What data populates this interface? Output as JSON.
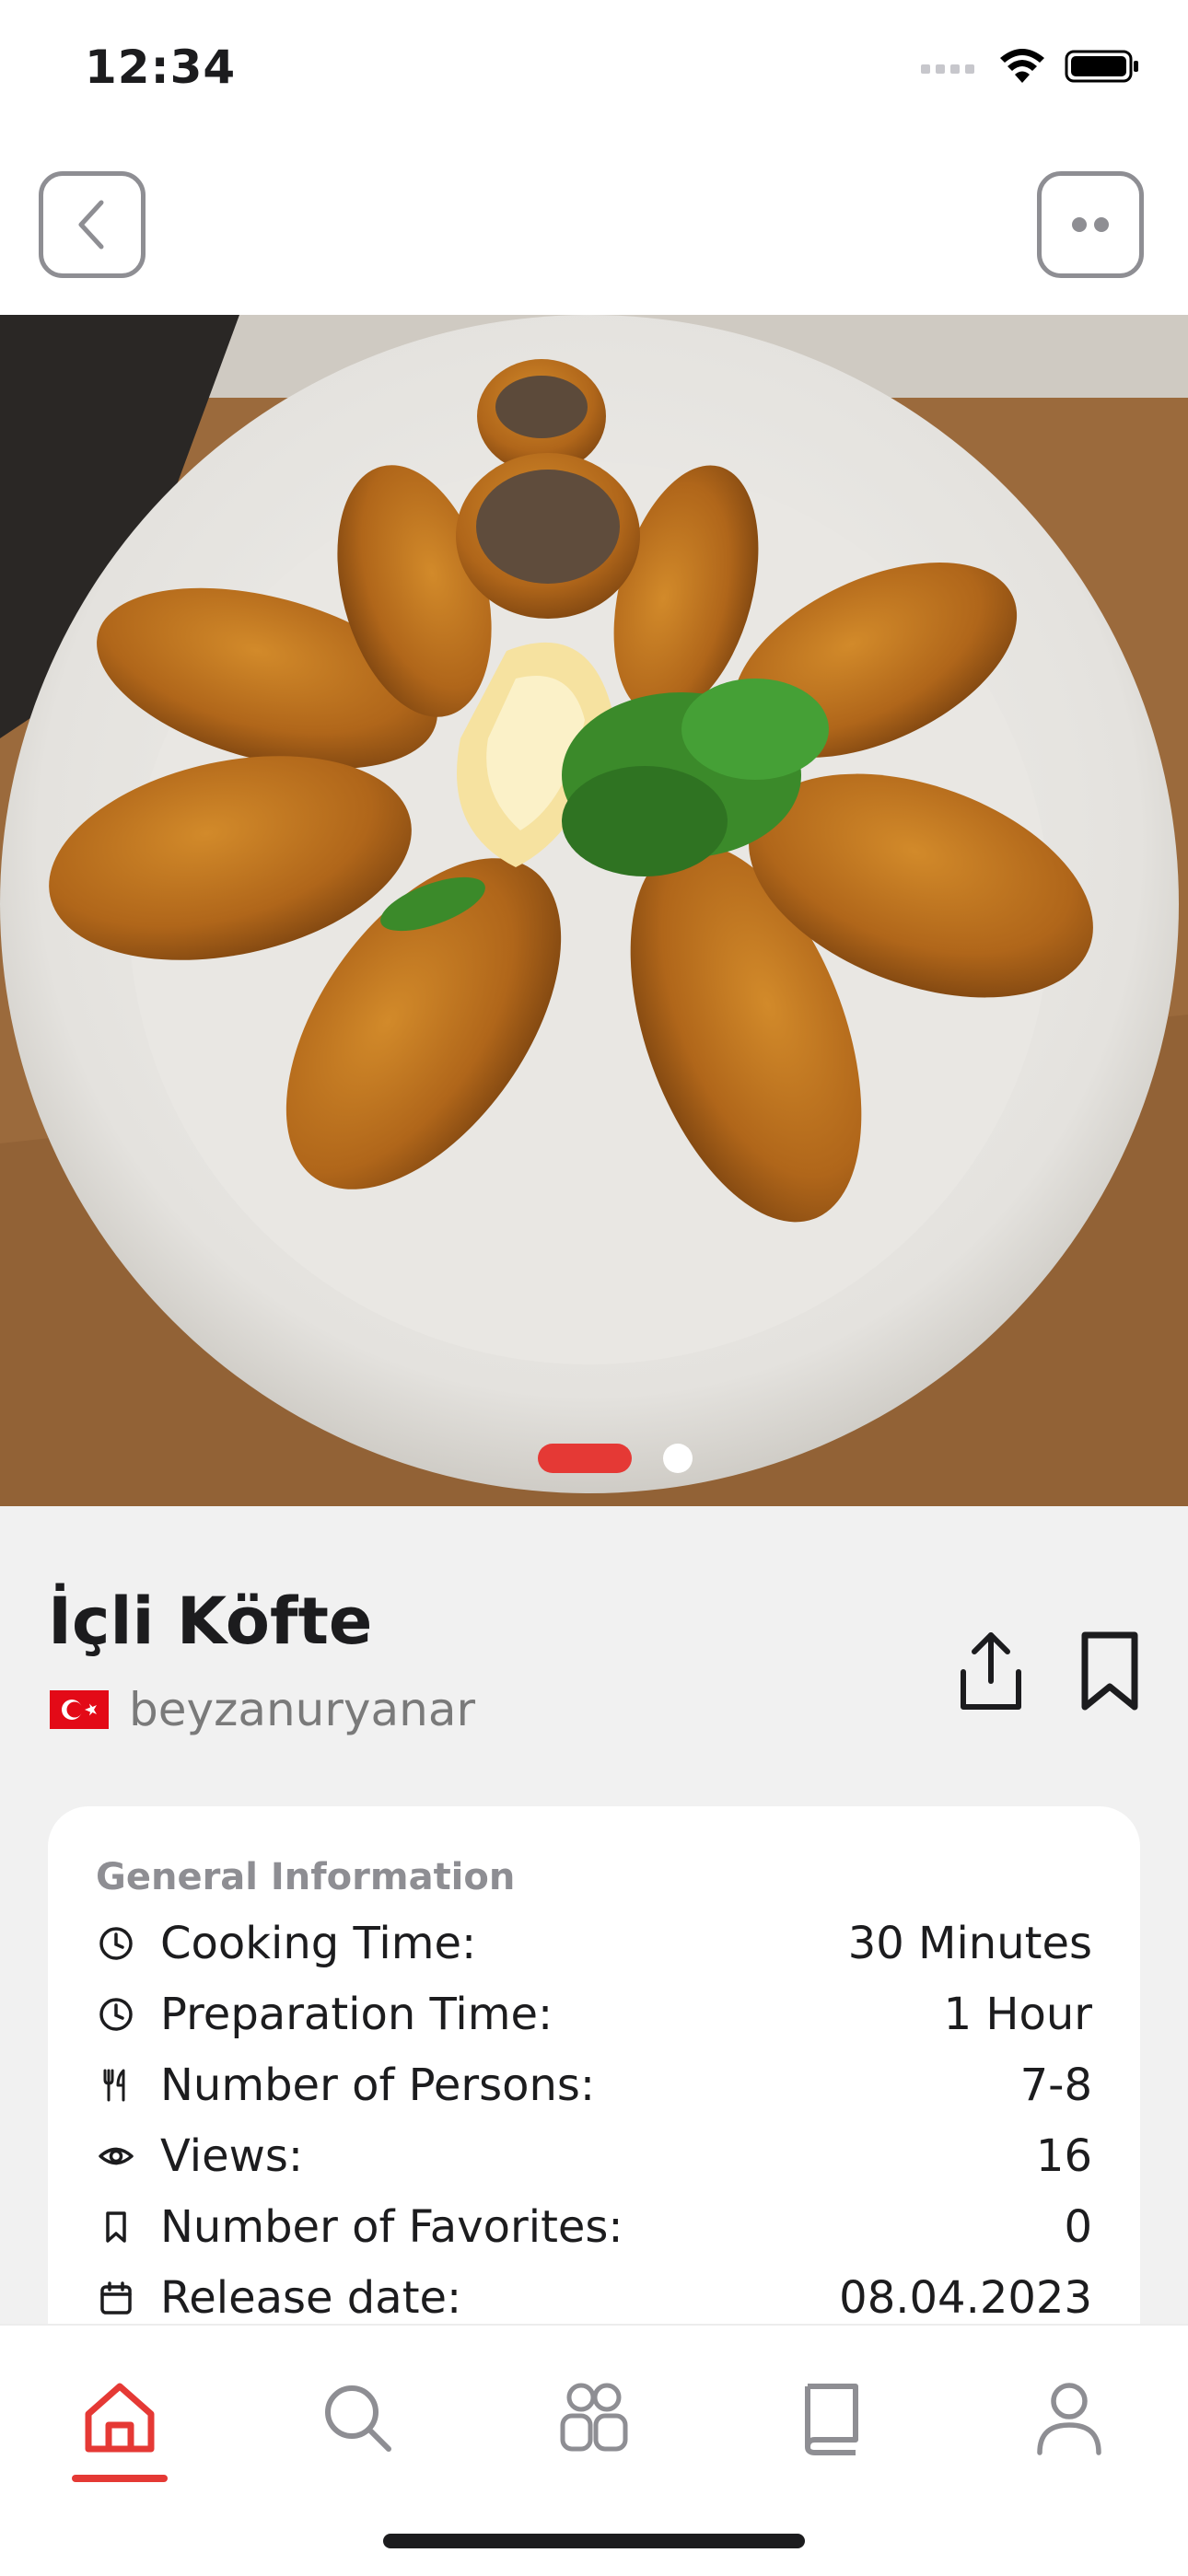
{
  "status_bar": {
    "time": "12:34"
  },
  "recipe": {
    "title": "İçli Köfte",
    "author": "beyzanuryanar",
    "carousel_index": 1,
    "carousel_count": 2
  },
  "general_info": {
    "title": "General Information",
    "rows": [
      {
        "icon": "clock-icon",
        "label": "Cooking Time:",
        "value": "30 Minutes"
      },
      {
        "icon": "clock-icon",
        "label": "Preparation Time:",
        "value": "1 Hour"
      },
      {
        "icon": "cutlery-icon",
        "label": "Number of Persons:",
        "value": "7-8"
      },
      {
        "icon": "eye-icon",
        "label": "Views:",
        "value": "16"
      },
      {
        "icon": "bookmark-icon",
        "label": "Number of Favorites:",
        "value": "0"
      },
      {
        "icon": "calendar-icon",
        "label": "Release date:",
        "value": "08.04.2023"
      }
    ]
  },
  "tabbar": {
    "items": [
      "home-icon",
      "search-icon",
      "community-icon",
      "book-icon",
      "profile-icon"
    ],
    "active": "home-icon"
  },
  "colors": {
    "accent": "#e53935",
    "background": "#f1f1f1",
    "card": "#ffffff",
    "muted": "#8e8e93"
  }
}
